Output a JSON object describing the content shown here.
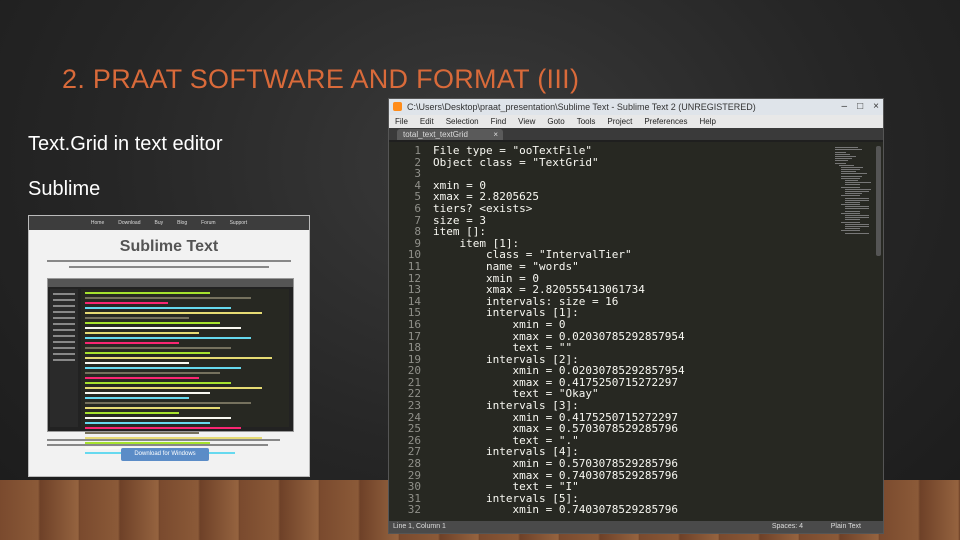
{
  "slide": {
    "title": "2. PRAAT SOFTWARE AND FORMAT (III)",
    "bullets": [
      "Text.Grid in text editor",
      "Sublime"
    ],
    "title_color": "#d96a3a"
  },
  "website": {
    "nav": [
      "Home",
      "Download",
      "Buy",
      "Blog",
      "Forum",
      "Support"
    ],
    "logo": "Sublime Text",
    "download_button": "Download for Windows"
  },
  "editor": {
    "window_title": "C:\\Users\\Desktop\\praat_presentation\\Sublime Text - Sublime Text 2 (UNREGISTERED)",
    "menu": [
      "File",
      "Edit",
      "Selection",
      "Find",
      "View",
      "Goto",
      "Tools",
      "Project",
      "Preferences",
      "Help"
    ],
    "tab_label": "total_text_textGrid",
    "tab_close": "×",
    "lines": [
      "File type = \"ooTextFile\"",
      "Object class = \"TextGrid\"",
      "",
      "xmin = 0",
      "xmax = 2.8205625",
      "tiers? <exists>",
      "size = 3",
      "item []:",
      "    item [1]:",
      "        class = \"IntervalTier\"",
      "        name = \"words\"",
      "        xmin = 0",
      "        xmax = 2.820555413061734",
      "        intervals: size = 16",
      "        intervals [1]:",
      "            xmin = 0",
      "            xmax = 0.02030785292857954",
      "            text = \"\"",
      "        intervals [2]:",
      "            xmin = 0.02030785292857954",
      "            xmax = 0.4175250715272297",
      "            text = \"Okay\"",
      "        intervals [3]:",
      "            xmin = 0.4175250715272297",
      "            xmax = 0.5703078529285796",
      "            text = \".\"",
      "        intervals [4]:",
      "            xmin = 0.5703078529285796",
      "            xmax = 0.7403078529285796",
      "            text = \"I\"",
      "        intervals [5]:",
      "            xmin = 0.7403078529285796"
    ],
    "status_left": "Line 1, Column 1",
    "status_spaces": "Spaces: 4",
    "status_syntax": "Plain Text"
  }
}
